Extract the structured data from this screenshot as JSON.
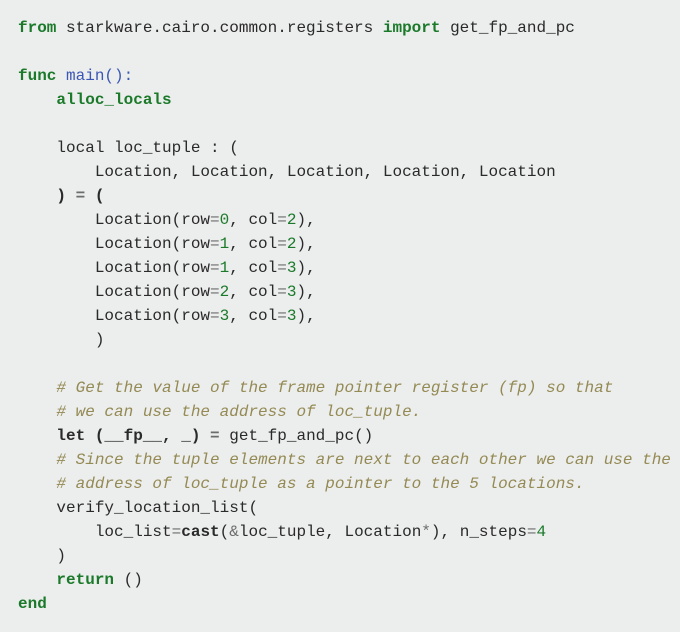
{
  "code": {
    "l1_from": "from",
    "l1_path": " starkware.cairo.common.registers ",
    "l1_import": "import",
    "l1_name": " get_fp_and_pc",
    "l3_func": "func",
    "l3_name": " main():",
    "l4_alloc": "alloc_locals",
    "l6": "    local loc_tuple : (",
    "l7": "        Location, Location, Location, Location, Location",
    "l8_a": "    ) ",
    "l8_eq": "=",
    "l8_b": " (",
    "row_pre": "        Location(row",
    "eq": "=",
    "col_pre": ", col",
    "close": "),",
    "r0": "0",
    "c0": "2",
    "r1": "1",
    "c1": "2",
    "r2": "1",
    "c2": "3",
    "r3": "2",
    "c3": "3",
    "r4": "3",
    "c4": "3",
    "l14": "        )",
    "cmt1": "    # Get the value of the frame pointer register (fp) so that",
    "cmt2": "    # we can use the address of loc_tuple.",
    "l18_let": "let",
    "l18_a": " (__fp__, _) ",
    "l18_eq": "=",
    "l18_b": " get_fp_and_pc()",
    "cmt3": "    # Since the tuple elements are next to each other we can use the",
    "cmt4": "    # address of loc_tuple as a pointer to the 5 locations.",
    "l21": "    verify_location_list(",
    "l22_a": "        loc_list",
    "l22_eq1": "=",
    "l22_cast": "cast",
    "l22_b": "(",
    "l22_amp": "&",
    "l22_c": "loc_tuple, Location",
    "l22_star": "*",
    "l22_d": "), n_steps",
    "l22_eq2": "=",
    "l22_n": "4",
    "l23": "    )",
    "l24_ret": "return",
    "l24_b": " ()",
    "l25_end": "end"
  }
}
